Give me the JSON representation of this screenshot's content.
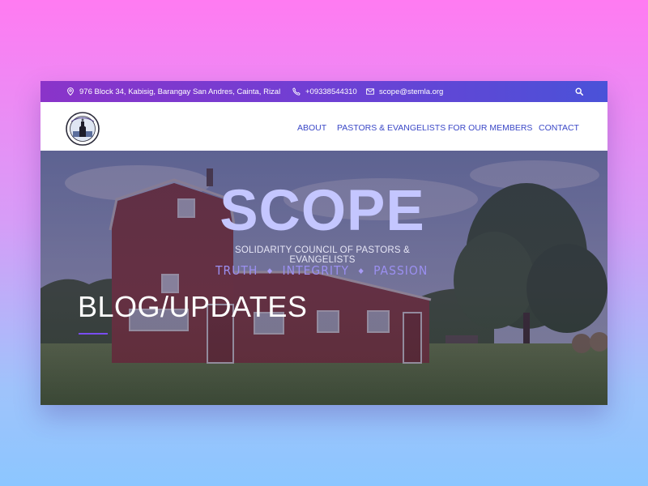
{
  "topbar": {
    "address": "976 Block 34, Kabisig, Barangay San Andres, Cainta, Rizal",
    "phone": "+09338544310",
    "email": "scope@stemla.org",
    "icons": {
      "address": "map-pin-icon",
      "phone": "phone-icon",
      "email": "envelope-icon",
      "search": "search-icon"
    }
  },
  "nav": {
    "logo_icon": "church-logo-icon",
    "items": [
      "ABOUT",
      "PASTORS & EVANGELISTS",
      "FOR OUR MEMBERS",
      "CONTACT"
    ]
  },
  "hero": {
    "brand": "SCOPE",
    "tagline": "SOLIDARITY COUNCIL OF PASTORS & EVANGELISTS",
    "motto": [
      "TRUTH",
      "INTEGRITY",
      "PASSION"
    ],
    "motto_separator": "◆",
    "page_title": "BLOG/UPDATES"
  },
  "colors": {
    "topbar_start": "#8a34c9",
    "topbar_end": "#4a52d8",
    "nav_link": "#3b48c7",
    "accent": "#7a4df0",
    "brand_text": "#c4c6ff"
  }
}
